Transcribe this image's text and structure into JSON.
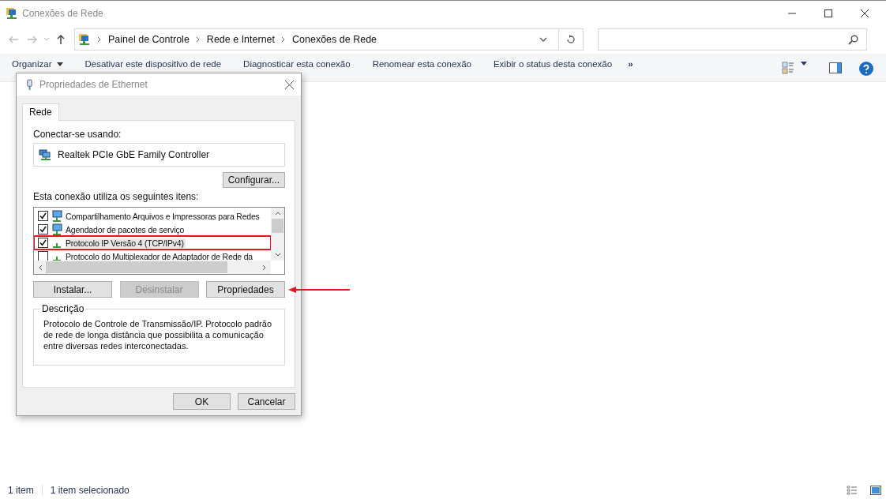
{
  "window": {
    "title": "Conexões de Rede"
  },
  "address": {
    "crumbs": [
      "Painel de Controle",
      "Rede e Internet",
      "Conexões de Rede"
    ]
  },
  "toolbar": {
    "items": [
      {
        "label": "Organizar",
        "dropdown": true
      },
      {
        "label": "Desativar este dispositivo de rede",
        "dropdown": false
      },
      {
        "label": "Diagnosticar esta conexão",
        "dropdown": false
      },
      {
        "label": "Renomear esta conexão",
        "dropdown": false
      },
      {
        "label": "Exibir o status desta conexão",
        "dropdown": false
      }
    ],
    "more": "»"
  },
  "dialog": {
    "title": "Propriedades de Ethernet",
    "tabs": [
      {
        "label": "Rede",
        "selected": true
      }
    ],
    "connect_label": "Conectar-se usando:",
    "adapter": "Realtek PCIe GbE Family Controller",
    "configure_button": "Configurar...",
    "items_label": "Esta conexão utiliza os seguintes itens:",
    "items": [
      {
        "label": "Compartilhamento Arquivos e Impressoras para Redes",
        "checked": true,
        "selected": false,
        "highlighted": false
      },
      {
        "label": "Agendador de pacotes de serviço",
        "checked": true,
        "selected": false,
        "highlighted": false
      },
      {
        "label": "Protocolo IP Versão 4 (TCP/IPv4)",
        "checked": true,
        "selected": true,
        "highlighted": true
      },
      {
        "label": "Protocolo do Multiplexador de Adaptador de Rede da",
        "checked": false,
        "selected": false,
        "highlighted": false
      }
    ],
    "buttons": [
      {
        "label": "Instalar...",
        "disabled": false
      },
      {
        "label": "Desinstalar",
        "disabled": true
      },
      {
        "label": "Propriedades",
        "disabled": false,
        "arrow": true
      }
    ],
    "description_title": "Descrição",
    "description": "Protocolo de Controle de Transmissão/IP. Protocolo padrão de rede de longa distância que possibilita a comunicação entre diversas redes interconectadas.",
    "footer_buttons": [
      "OK",
      "Cancelar"
    ]
  },
  "status_bar": {
    "count": "1 item",
    "selection": "1 item selecionado"
  }
}
